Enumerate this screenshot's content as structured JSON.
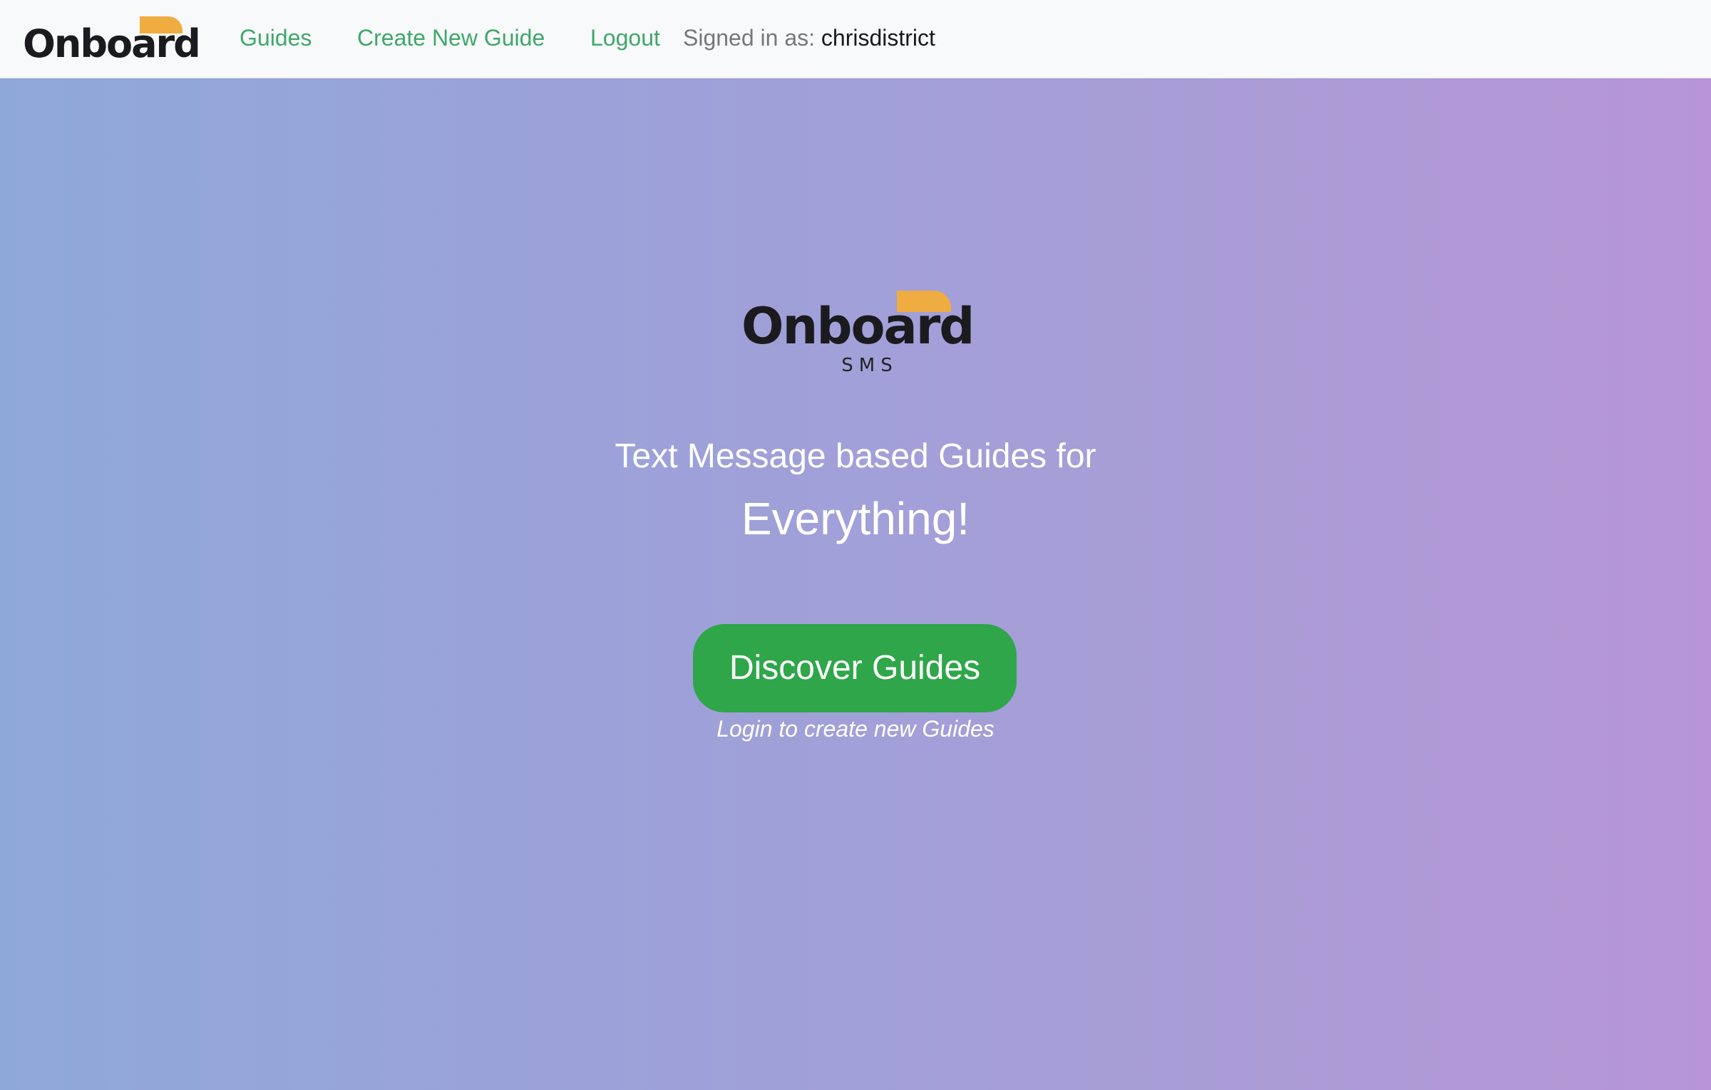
{
  "navbar": {
    "brand": "Onboard",
    "links": {
      "guides": "Guides",
      "create": "Create New Guide",
      "logout": "Logout"
    },
    "signed_in_label": "Signed in as:",
    "username": "chrisdistrict"
  },
  "hero": {
    "logo_wordmark": "Onboard",
    "logo_sub": "SMS",
    "tagline": "Text Message based Guides for",
    "tagline_big": "Everything!",
    "discover_button": "Discover Guides",
    "login_note": "Login to create new Guides"
  },
  "colors": {
    "link_green": "#3ea86a",
    "button_green": "#2fa64a",
    "logo_accent": "#eeac41",
    "gradient_start": "#8fa8da",
    "gradient_end": "#b795d6"
  }
}
